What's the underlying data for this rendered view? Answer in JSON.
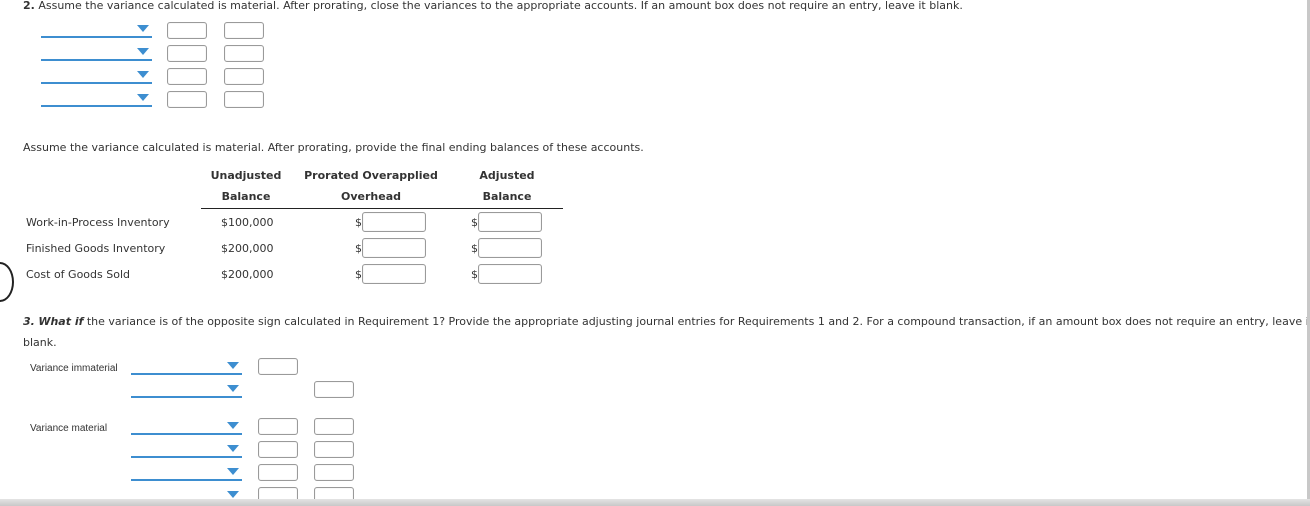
{
  "requirement2": {
    "number": "2.",
    "instruction": " Assume the variance calculated is material. After prorating, close the variances to the appropriate accounts. If an amount box does not require an entry, leave it blank.",
    "journal_rows": 4
  },
  "balances": {
    "instruction": "Assume the variance calculated is material. After prorating, provide the final ending balances of these accounts.",
    "headers": [
      {
        "line1": "Unadjusted",
        "line2": "Balance"
      },
      {
        "line1": "Prorated Overapplied",
        "line2": "Overhead"
      },
      {
        "line1": "Adjusted",
        "line2": "Balance"
      }
    ],
    "currency_symbol": "$",
    "rows": [
      {
        "account": "Work-in-Process Inventory",
        "unadjusted": "$100,000",
        "prorated": "",
        "adjusted": ""
      },
      {
        "account": "Finished Goods Inventory",
        "unadjusted": "$200,000",
        "prorated": "",
        "adjusted": ""
      },
      {
        "account": "Cost of Goods Sold",
        "unadjusted": "$200,000",
        "prorated": "",
        "adjusted": ""
      }
    ]
  },
  "requirement3": {
    "number": "3.",
    "what_if": "What if",
    "instruction": " the variance is of the opposite sign calculated in Requirement 1? Provide the appropriate adjusting journal entries for Requirements 1 and 2. For a compound transaction, if an amount box does not require an entry, leave it",
    "instruction_cont": "blank.",
    "groups": [
      {
        "label": "Variance immaterial"
      },
      {
        "label": "Variance material"
      }
    ]
  },
  "colors": {
    "accent": "#3d8ed0",
    "border": "#9a9a9a",
    "text": "#333333"
  }
}
